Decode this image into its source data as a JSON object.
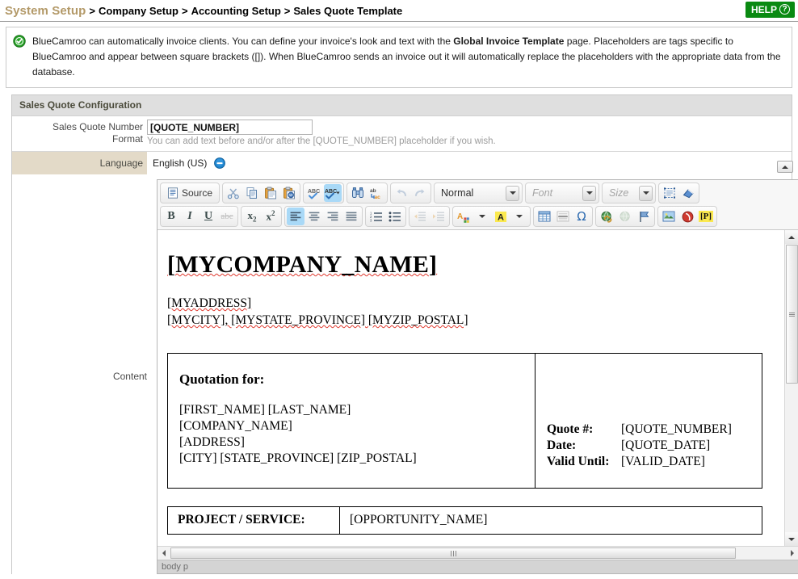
{
  "breadcrumb": {
    "root": "System Setup",
    "separator": ">",
    "items": [
      "Company Setup",
      "Accounting Setup",
      "Sales Quote Template"
    ]
  },
  "help": {
    "label": "HELP",
    "icon": "question-mark-circle-icon",
    "glyph": "?",
    "color": "#0a8a12"
  },
  "notice": {
    "icon": "green-check-circle-icon",
    "text_before": "BlueCamroo can automatically invoice clients. You can define your invoice's look and text with the ",
    "bold": "Global Invoice Template",
    "text_after": " page. Placeholders are tags specific to BlueCamroo and appear between square brackets ([]). When BlueCamroo sends an invoice out it will automatically replace the placeholders with the appropriate data from the database."
  },
  "panel": {
    "section_title": "Sales Quote Configuration",
    "quote_format": {
      "label_line1": "Sales Quote Number",
      "label_line2": "Format",
      "value": "[QUOTE_NUMBER]",
      "placeholder": "[QUOTE_NUMBER]",
      "hint": "You can add text before and/or after the [QUOTE_NUMBER] placeholder if you wish."
    },
    "language": {
      "label": "Language",
      "value": "English (US)",
      "remove_icon": "blue-minus-circle-icon"
    },
    "content": {
      "label": "Content"
    }
  },
  "editor": {
    "collapse_icon": "collapse-toolbar-icon",
    "toolbar_row1": [
      {
        "group": 1,
        "name": "source-button",
        "label": "Source",
        "icon": "source-code-icon",
        "state": "normal"
      },
      {
        "group": 2,
        "name": "cut-button",
        "label": "Cut",
        "icon": "scissors-icon",
        "state": "normal"
      },
      {
        "group": 2,
        "name": "copy-button",
        "label": "Copy",
        "icon": "copy-icon",
        "state": "normal"
      },
      {
        "group": 2,
        "name": "paste-button",
        "label": "Paste",
        "icon": "paste-icon",
        "state": "normal"
      },
      {
        "group": 2,
        "name": "paste-from-word-button",
        "label": "Paste from Word",
        "icon": "paste-word-icon",
        "state": "normal"
      },
      {
        "group": 3,
        "name": "spellcheck-button",
        "label": "Check Spelling",
        "icon": "abc-check-icon",
        "state": "normal"
      },
      {
        "group": 3,
        "name": "spellcheck-options-button",
        "label": "Spell Check As You Type",
        "icon": "abc-check-dropdown-icon",
        "state": "active"
      },
      {
        "group": 4,
        "name": "find-button",
        "label": "Find",
        "icon": "binoculars-icon",
        "state": "normal"
      },
      {
        "group": 4,
        "name": "replace-button",
        "label": "Replace",
        "icon": "replace-icon",
        "state": "normal"
      },
      {
        "group": 5,
        "name": "undo-button",
        "label": "Undo",
        "icon": "undo-arrow-icon",
        "state": "disabled"
      },
      {
        "group": 5,
        "name": "redo-button",
        "label": "Redo",
        "icon": "redo-arrow-icon",
        "state": "disabled"
      }
    ],
    "combos": [
      {
        "name": "paragraph-format-select",
        "value": "Normal",
        "muted": false
      },
      {
        "name": "font-family-select",
        "value": "Font",
        "muted": true
      },
      {
        "name": "font-size-select",
        "value": "Size",
        "muted": true
      }
    ],
    "toolbar_row1_tail": [
      {
        "name": "show-blocks-button",
        "label": "Show Blocks",
        "icon": "show-blocks-icon",
        "state": "normal"
      },
      {
        "name": "remove-format-button",
        "label": "Remove Format",
        "icon": "eraser-icon",
        "state": "normal"
      }
    ],
    "toolbar_row2": [
      {
        "group": 1,
        "name": "bold-button",
        "label": "Bold",
        "icon": "bold-icon",
        "glyph": "B",
        "state": "normal"
      },
      {
        "group": 1,
        "name": "italic-button",
        "label": "Italic",
        "icon": "italic-icon",
        "glyph": "I",
        "state": "normal"
      },
      {
        "group": 1,
        "name": "underline-button",
        "label": "Underline",
        "icon": "underline-icon",
        "glyph": "U",
        "state": "normal"
      },
      {
        "group": 1,
        "name": "strikethrough-button",
        "label": "Strike Through",
        "icon": "strikethrough-icon",
        "glyph": "abc",
        "state": "disabled"
      },
      {
        "group": 2,
        "name": "subscript-button",
        "label": "Subscript",
        "icon": "subscript-icon",
        "state": "normal"
      },
      {
        "group": 2,
        "name": "superscript-button",
        "label": "Superscript",
        "icon": "superscript-icon",
        "state": "normal"
      },
      {
        "group": 3,
        "name": "align-left-button",
        "label": "Align Left",
        "icon": "align-left-icon",
        "state": "active"
      },
      {
        "group": 3,
        "name": "align-center-button",
        "label": "Center",
        "icon": "align-center-icon",
        "state": "normal"
      },
      {
        "group": 3,
        "name": "align-right-button",
        "label": "Align Right",
        "icon": "align-right-icon",
        "state": "normal"
      },
      {
        "group": 3,
        "name": "align-justify-button",
        "label": "Justify",
        "icon": "align-justify-icon",
        "state": "normal"
      },
      {
        "group": 4,
        "name": "numbered-list-button",
        "label": "Insert/Remove Numbered List",
        "icon": "numbered-list-icon",
        "state": "normal"
      },
      {
        "group": 4,
        "name": "bulleted-list-button",
        "label": "Insert/Remove Bulleted List",
        "icon": "bulleted-list-icon",
        "state": "normal"
      },
      {
        "group": 5,
        "name": "outdent-button",
        "label": "Decrease Indent",
        "icon": "outdent-icon",
        "state": "disabled"
      },
      {
        "group": 5,
        "name": "indent-button",
        "label": "Increase Indent",
        "icon": "indent-icon",
        "state": "disabled"
      },
      {
        "group": 6,
        "name": "text-color-button",
        "label": "Text Color",
        "icon": "text-color-icon",
        "state": "normal"
      },
      {
        "group": 6,
        "name": "background-color-button",
        "label": "Background Color",
        "icon": "background-color-icon",
        "state": "normal"
      },
      {
        "group": 7,
        "name": "table-button",
        "label": "Table",
        "icon": "table-icon",
        "state": "normal"
      },
      {
        "group": 7,
        "name": "horizontal-rule-button",
        "label": "Insert Horizontal Line",
        "icon": "horizontal-rule-icon",
        "state": "normal"
      },
      {
        "group": 7,
        "name": "special-character-button",
        "label": "Insert Special Character",
        "icon": "omega-icon",
        "glyph": "Ω",
        "state": "normal"
      },
      {
        "group": 8,
        "name": "link-button",
        "label": "Link",
        "icon": "globe-link-icon",
        "state": "normal"
      },
      {
        "group": 8,
        "name": "unlink-button",
        "label": "Unlink",
        "icon": "globe-unlink-icon",
        "state": "disabled"
      },
      {
        "group": 8,
        "name": "anchor-button",
        "label": "Anchor",
        "icon": "flag-anchor-icon",
        "state": "normal"
      },
      {
        "group": 9,
        "name": "image-button",
        "label": "Image",
        "icon": "image-icon",
        "state": "normal"
      },
      {
        "group": 9,
        "name": "flash-button",
        "label": "Flash",
        "icon": "flash-icon",
        "state": "normal"
      },
      {
        "group": 9,
        "name": "placeholder-button",
        "label": "[P]",
        "icon": "placeholder-icon",
        "state": "normal"
      }
    ],
    "element_path": "body  p"
  },
  "document": {
    "company_name": "[MYCOMPANY_NAME]",
    "address": "[MYADDRESS]",
    "city_line": "[MYCITY], [MYSTATE_PROVINCE] [MYZIP_POSTAL]",
    "quotation_heading": "Quotation for:",
    "recipient_lines": [
      "[FIRST_NAME] [LAST_NAME]",
      "[COMPANY_NAME]",
      "[ADDRESS]",
      "[CITY] [STATE_PROVINCE] [ZIP_POSTAL]"
    ],
    "meta": [
      {
        "key": "Quote #:",
        "value": "[QUOTE_NUMBER]"
      },
      {
        "key": "Date:",
        "value": "[QUOTE_DATE]"
      },
      {
        "key": "Valid Until:",
        "value": "[VALID_DATE]"
      }
    ],
    "project_label": "PROJECT / SERVICE:",
    "project_value": "[OPPORTUNITY_NAME]"
  }
}
